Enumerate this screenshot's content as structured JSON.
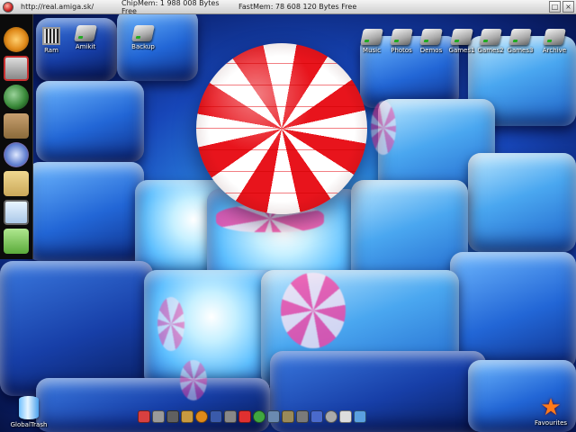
{
  "topbar": {
    "url": "http://real.amiga.sk/",
    "chipmem": "ChipMem: 1 988 008 Bytes Free",
    "fastmem": "FastMem: 78 608 120 Bytes Free",
    "depth_button": "□",
    "close_button": "×"
  },
  "desktop_icons_left": [
    {
      "label": "Ram",
      "icon": "ram-chip-icon"
    },
    {
      "label": "Amikit",
      "icon": "drive-icon"
    },
    {
      "label": "Backup",
      "icon": "drive-icon"
    }
  ],
  "desktop_icons_right": [
    {
      "label": "Music",
      "icon": "drive-icon"
    },
    {
      "label": "Photos",
      "icon": "drive-icon"
    },
    {
      "label": "Demos",
      "icon": "drive-icon"
    },
    {
      "label": "Games1",
      "icon": "drive-icon"
    },
    {
      "label": "Games2",
      "icon": "drive-icon"
    },
    {
      "label": "Games3",
      "icon": "drive-icon"
    },
    {
      "label": "Archive",
      "icon": "drive-icon"
    }
  ],
  "trash": {
    "label": "GlobalTrash",
    "icon": "trash-can-icon"
  },
  "favourites": {
    "label": "Favourites",
    "icon": "star-icon"
  },
  "left_dock": [
    {
      "icon": "power-icon",
      "color": "#e08a1a"
    },
    {
      "icon": "window-manager-icon",
      "color": "#c83030"
    },
    {
      "icon": "globe-icon",
      "color": "#3a8a3a"
    },
    {
      "icon": "user-icon",
      "color": "#8a6a3a"
    },
    {
      "icon": "gear-arrow-icon",
      "color": "#5a7acc"
    },
    {
      "icon": "face-icon",
      "color": "#caa85a"
    },
    {
      "icon": "magnifier-icon",
      "color": "#aac8e8"
    },
    {
      "icon": "lightning-icon",
      "color": "#5aaa3a"
    }
  ],
  "bottom_dock": [
    {
      "icon": "movie-icon",
      "color": "#d84040"
    },
    {
      "icon": "toolbox-icon",
      "color": "#9a9a9a"
    },
    {
      "icon": "shell-icon",
      "color": "#606060"
    },
    {
      "icon": "disk-icon",
      "color": "#c89a40"
    },
    {
      "icon": "power-icon",
      "color": "#e08a1a"
    },
    {
      "icon": "monitor-icon",
      "color": "#3a5aaa"
    },
    {
      "icon": "prefs-icon",
      "color": "#888888"
    },
    {
      "icon": "invader-icon",
      "color": "#e03030"
    },
    {
      "icon": "dollar-icon",
      "color": "#40a840"
    },
    {
      "icon": "network-icon",
      "color": "#6a8ab0"
    },
    {
      "icon": "tools-icon",
      "color": "#9a8a5a"
    },
    {
      "icon": "chart-icon",
      "color": "#7a7a7a"
    },
    {
      "icon": "screen-icon",
      "color": "#4a6acc"
    },
    {
      "icon": "settings-icon",
      "color": "#aaaaaa"
    },
    {
      "icon": "notepad-icon",
      "color": "#dddddd"
    },
    {
      "icon": "search-icon",
      "color": "#5aa0e0"
    }
  ],
  "colors": {
    "ball_red": "#e8141c",
    "ball_white": "#ffffff",
    "wallpaper_blue": "#1746b8"
  }
}
